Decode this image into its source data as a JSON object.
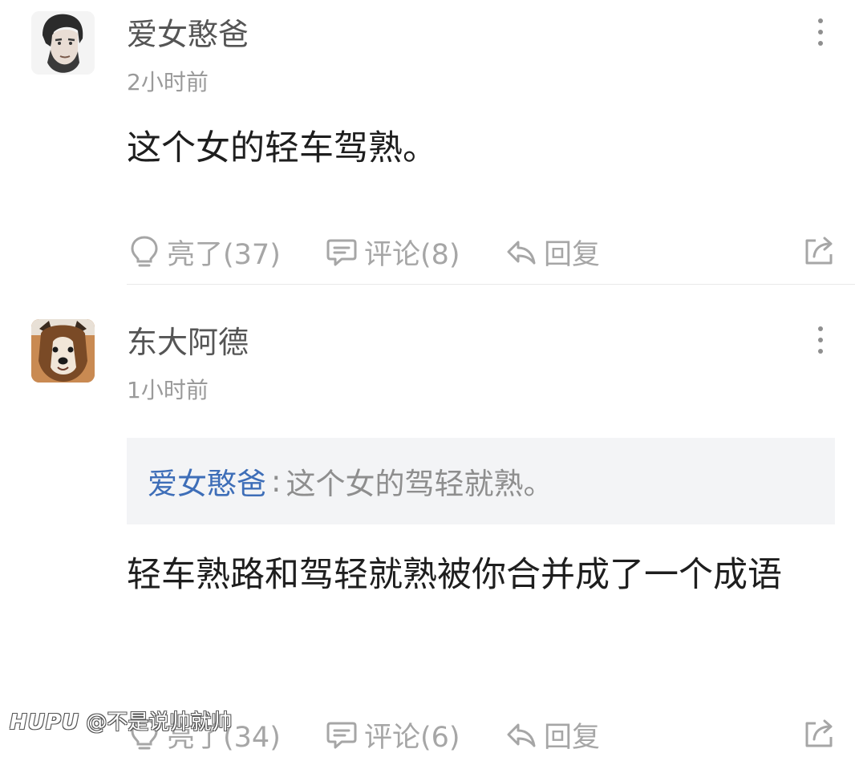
{
  "comments": [
    {
      "username": "爱女憨爸",
      "time": "2小时前",
      "text": "这个女的轻车驾熟。",
      "actions": {
        "like": "亮了(37)",
        "comment": "评论(8)",
        "reply": "回复"
      }
    },
    {
      "username": "东大阿德",
      "time": "1小时前",
      "quote": {
        "author": "爱女憨爸",
        "separator": ":",
        "text": "这个女的驾轻就熟。"
      },
      "text": "轻车熟路和驾轻就熟被你合并成了一个成语",
      "actions": {
        "like": "亮了(34)",
        "comment": "评论(6)",
        "reply": "回复"
      }
    }
  ],
  "watermark": {
    "brand": "HUPU",
    "user": "@不是说帅就帅"
  },
  "colors": {
    "link": "#3e6eb8",
    "muted": "#a6a6a6",
    "quote_bg": "#f3f4f6"
  },
  "icons": [
    "more-vert-icon",
    "lightbulb-icon",
    "comment-icon",
    "reply-icon",
    "share-icon"
  ]
}
